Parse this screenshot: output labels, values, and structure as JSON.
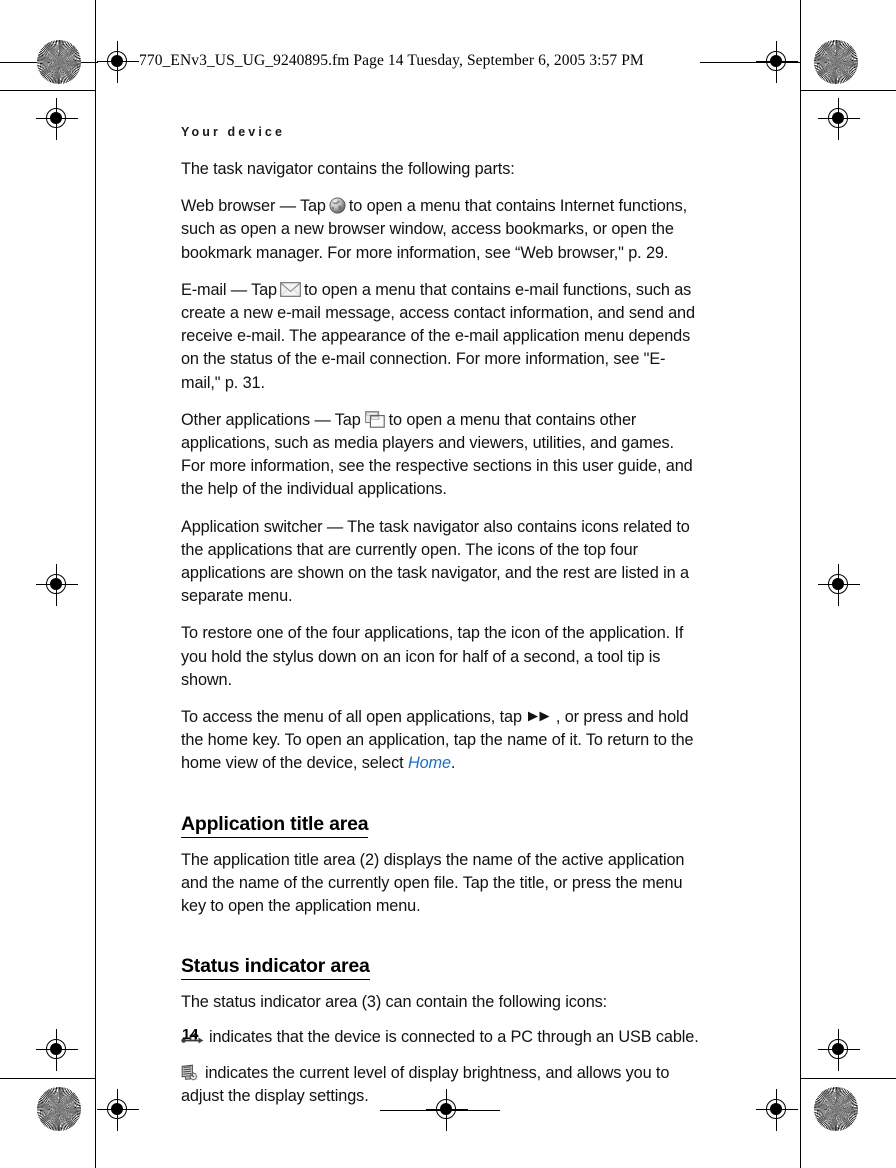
{
  "print_marks": {
    "rosette_name": "color-registration-rosette",
    "target_name": "registration-crosshair-target"
  },
  "header": {
    "filename_line": "770_ENv3_US_UG_9240895.fm  Page 14  Tuesday, September 6, 2005  3:57 PM"
  },
  "running_head": "Your device",
  "page_number": "14",
  "body": {
    "intro": "The task navigator contains the following parts:",
    "web_browser": {
      "lead": "Web browser — Tap",
      "icon": "globe-icon",
      "rest": "to open a menu that contains Internet functions, such as open a new browser window, access bookmarks, or open the bookmark manager. For more information, see “Web browser,\" p. 29."
    },
    "email": {
      "lead": "E-mail — Tap",
      "icon": "envelope-icon",
      "rest": "to open a menu that contains e-mail functions, such as create a new e-mail message, access contact information, and send and receive e-mail. The appearance of the e-mail application menu depends on the status of the e-mail connection. For more information, see \"E-mail,\" p. 31."
    },
    "other_applications": {
      "lead": "Other applications — Tap",
      "icon": "stacked-windows-icon",
      "rest": "to open a menu that contains other applications, such as media players and viewers, utilities, and games. For more information, see the respective sections in this user guide, and the help of the individual applications."
    },
    "application_switcher": "Application switcher — The task navigator also contains icons related to the applications that are currently open. The icons of the top four applications are shown on the task navigator, and the rest are listed in a separate menu.",
    "restore": "To restore one of the four applications, tap the icon of the application. If you hold the stylus down on an icon for half of a second, a tool tip is shown.",
    "access_menu": {
      "lead": "To access the menu of all open applications, tap",
      "icon": "fast-forward-icon",
      "mid": ", or press and hold the home key. To open an application, tap the name of it. To return to the home view of the device, select",
      "link": "Home",
      "end": "."
    }
  },
  "sections": {
    "application_title_area": {
      "heading": "Application title area",
      "text": "The application title area (2) displays the name of the active application and the name of the currently open file. Tap the title, or press the menu key to open the application menu."
    },
    "status_indicator_area": {
      "heading": "Status indicator area",
      "intro": "The status indicator area (3) can contain the following icons:",
      "usb": {
        "icon": "usb-connection-icon",
        "text": "indicates that the device is connected to a PC through an USB cable."
      },
      "brightness": {
        "icon": "display-brightness-icon",
        "text": "indicates the current level of display brightness, and allows you to adjust the display settings."
      }
    }
  },
  "colors": {
    "link": "#1b6fc4",
    "text": "#111111",
    "paper": "#ffffff"
  }
}
